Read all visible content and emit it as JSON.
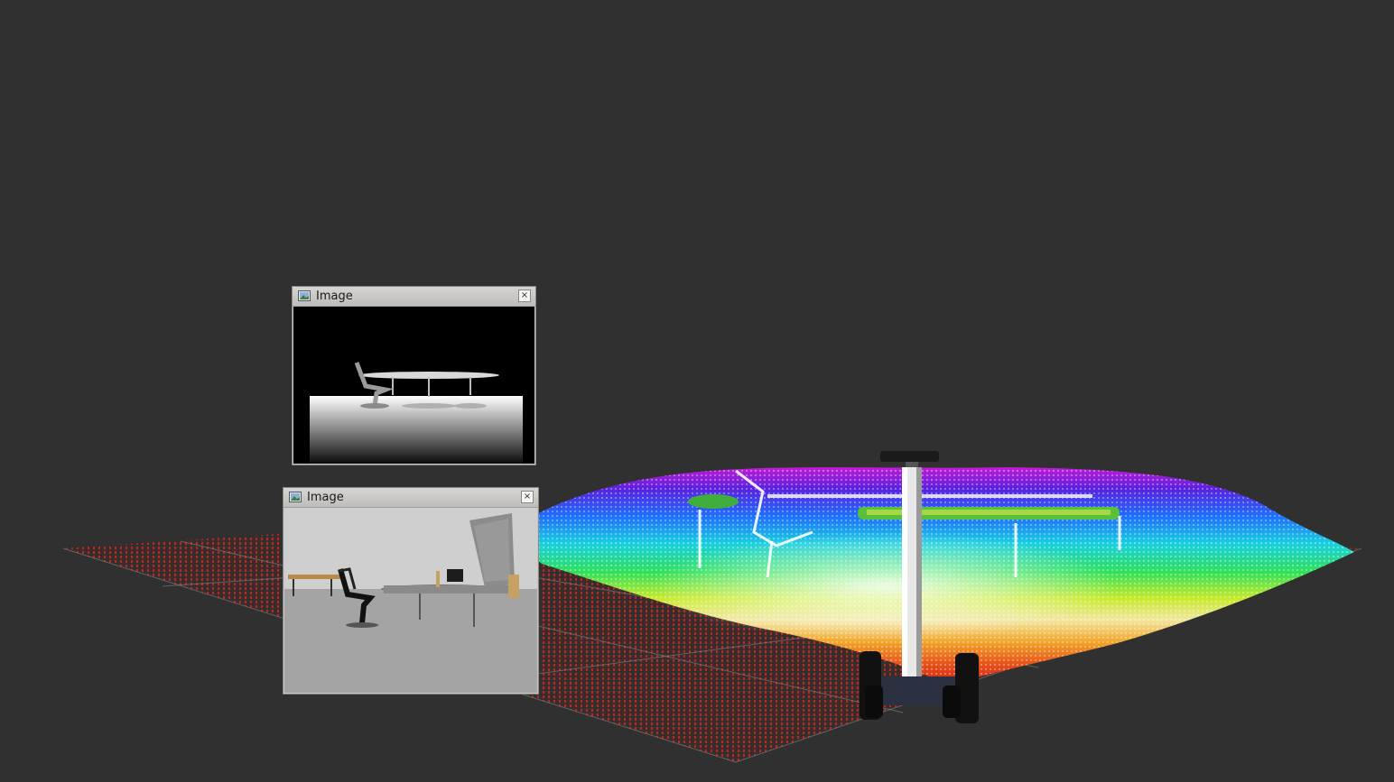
{
  "viewport": {
    "background": "#303030"
  },
  "depth_window": {
    "title": "Image",
    "icon": "image-icon",
    "close_symbol": "×"
  },
  "rgb_window": {
    "title": "Image",
    "icon": "image-icon",
    "close_symbol": "×"
  },
  "scene": {
    "ground_color": "#d21e14",
    "robot_color": "#141414",
    "mast_color": "#e8e8e8"
  }
}
